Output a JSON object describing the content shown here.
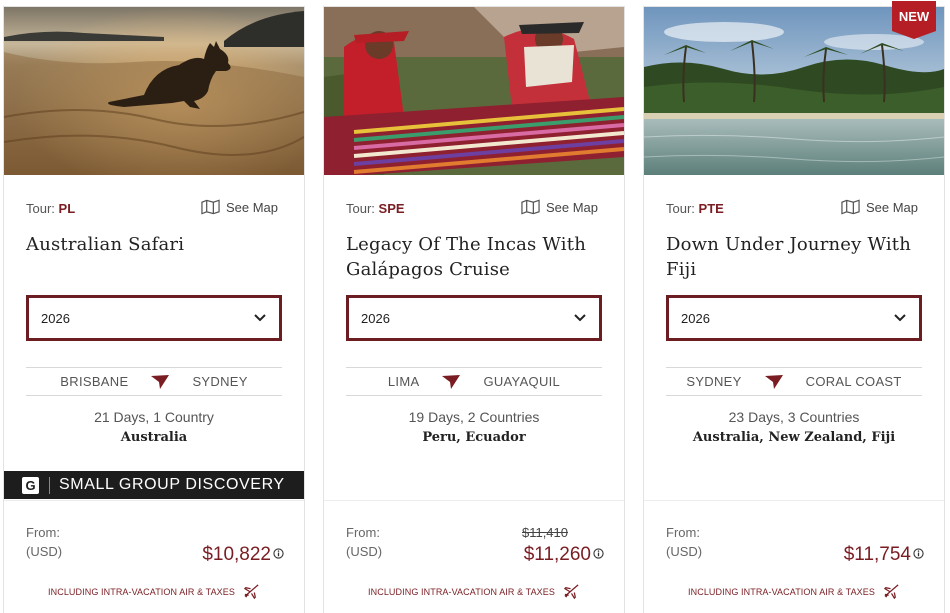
{
  "tours": [
    {
      "tour_label": "Tour:",
      "code": "PL",
      "see_map": "See Map",
      "title": "Australian Safari",
      "year": "2026",
      "route_from": "BRISBANE",
      "route_to": "SYDNEY",
      "duration": "21 Days, 1 Country",
      "countries": "Australia",
      "banner": {
        "logo": "G",
        "text": "SMALL GROUP DISCOVERY"
      },
      "from_label": "From:",
      "currency": "(USD)",
      "old_price": "",
      "price": "$10,822",
      "inclusion": "INCLUDING INTRA-VACATION AIR & TAXES",
      "image": "kangaroo-on-beach-at-sunset"
    },
    {
      "tour_label": "Tour:",
      "code": "SPE",
      "see_map": "See Map",
      "title": "Legacy Of The Incas With Galápagos Cruise",
      "year": "2026",
      "route_from": "LIMA",
      "route_to": "GUAYAQUIL",
      "duration": "19 Days, 2 Countries",
      "countries": "Peru, Ecuador",
      "from_label": "From:",
      "currency": "(USD)",
      "old_price": "$11,410",
      "price": "$11,260",
      "inclusion": "INCLUDING INTRA-VACATION AIR & TAXES",
      "image": "andean-weavers-at-loom"
    },
    {
      "tour_label": "Tour:",
      "code": "PTE",
      "see_map": "See Map",
      "title": "Down Under Journey With Fiji",
      "year": "2026",
      "route_from": "SYDNEY",
      "route_to": "CORAL COAST",
      "duration": "23 Days, 3 Countries",
      "countries": "Australia, New Zealand, Fiji",
      "from_label": "From:",
      "currency": "(USD)",
      "old_price": "",
      "price": "$11,754",
      "inclusion": "INCLUDING INTRA-VACATION AIR & TAXES",
      "badge": "NEW",
      "image": "tropical-palm-beach-lagoon"
    }
  ],
  "colors": {
    "accent": "#7a1d22",
    "badge": "#b51e24",
    "banner": "#1d1d1d"
  },
  "icons": {
    "map": "map-icon",
    "chevron": "chevron-down-icon",
    "route": "plane-arrow-icon",
    "info": "info-icon",
    "air": "airplane-icon"
  }
}
